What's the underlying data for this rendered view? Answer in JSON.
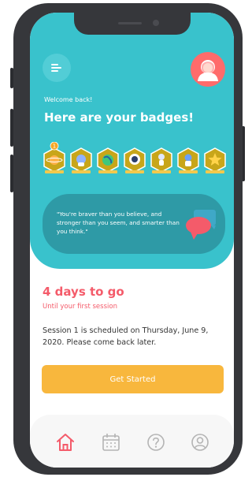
{
  "header": {
    "welcome": "Welcome back!",
    "title": "Here are your badges!"
  },
  "badges": {
    "notification_count": "1",
    "items": [
      {
        "icon": "planet-badge-icon",
        "color": "#ffb34a"
      },
      {
        "icon": "astronaut-badge-icon",
        "color": "#8fb2ff"
      },
      {
        "icon": "earth-badge-icon",
        "color": "#3ec77c"
      },
      {
        "icon": "astronaut-face-badge-icon",
        "color": "#ffffff"
      },
      {
        "icon": "astronaut-walk-badge-icon",
        "color": "#dfe7ff"
      },
      {
        "icon": "spaceman-badge-icon",
        "color": "#6aa0ff"
      },
      {
        "icon": "star-badge-icon",
        "color": "#ffd34a"
      }
    ]
  },
  "quote": {
    "text": "\"You're braver than you believe, and stronger than you seem, and smarter than you think.\""
  },
  "session": {
    "countdown": "4 days to go",
    "subtitle": "Until your first session",
    "schedule": "Session 1 is scheduled on Thursday, June 9, 2020. Please come back later."
  },
  "actions": {
    "start_label": "Get Started"
  },
  "nav": {
    "items": [
      {
        "icon": "home-icon",
        "active": true
      },
      {
        "icon": "calendar-icon",
        "active": false
      },
      {
        "icon": "help-icon",
        "active": false
      },
      {
        "icon": "profile-icon",
        "active": false
      }
    ]
  },
  "colors": {
    "hero": "#39c2cc",
    "quote_card": "#2e9aa6",
    "accent_red": "#f45b6a",
    "button": "#f8b73d",
    "badge_hex": "#c8a61a"
  }
}
